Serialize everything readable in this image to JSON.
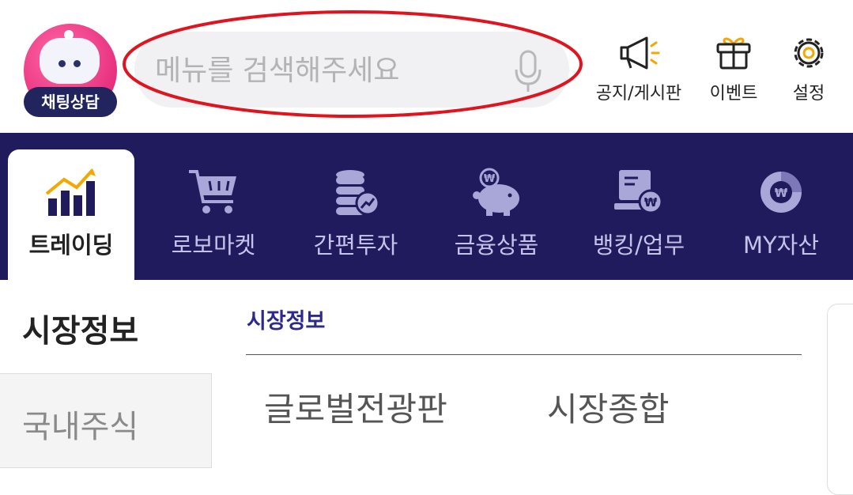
{
  "header": {
    "chatbot_label": "채팅상담",
    "search_placeholder": "메뉴를 검색해주세요",
    "actions": [
      {
        "label": "공지/게시판",
        "icon": "megaphone-icon"
      },
      {
        "label": "이벤트",
        "icon": "gift-icon"
      },
      {
        "label": "설정",
        "icon": "gear-icon"
      }
    ]
  },
  "nav": {
    "tabs": [
      {
        "label": "트레이딩",
        "icon": "trading-chart-icon",
        "active": true
      },
      {
        "label": "로보마켓",
        "icon": "cart-icon"
      },
      {
        "label": "간편투자",
        "icon": "coins-stack-icon"
      },
      {
        "label": "금융상품",
        "icon": "piggy-bank-icon"
      },
      {
        "label": "뱅킹/업무",
        "icon": "banking-terminal-icon"
      },
      {
        "label": "MY자산",
        "icon": "asset-donut-icon"
      }
    ]
  },
  "sidebar": {
    "title": "시장정보",
    "items": [
      {
        "label": "국내주식"
      }
    ]
  },
  "main": {
    "section_title": "시장정보",
    "links": [
      {
        "label": "글로벌전광판"
      },
      {
        "label": "시장종합"
      }
    ]
  },
  "colors": {
    "nav_bg": "#1f1b5c",
    "accent_pink": "#e8307e",
    "highlight_red": "#e0141e",
    "section_title": "#2d2a8a"
  }
}
